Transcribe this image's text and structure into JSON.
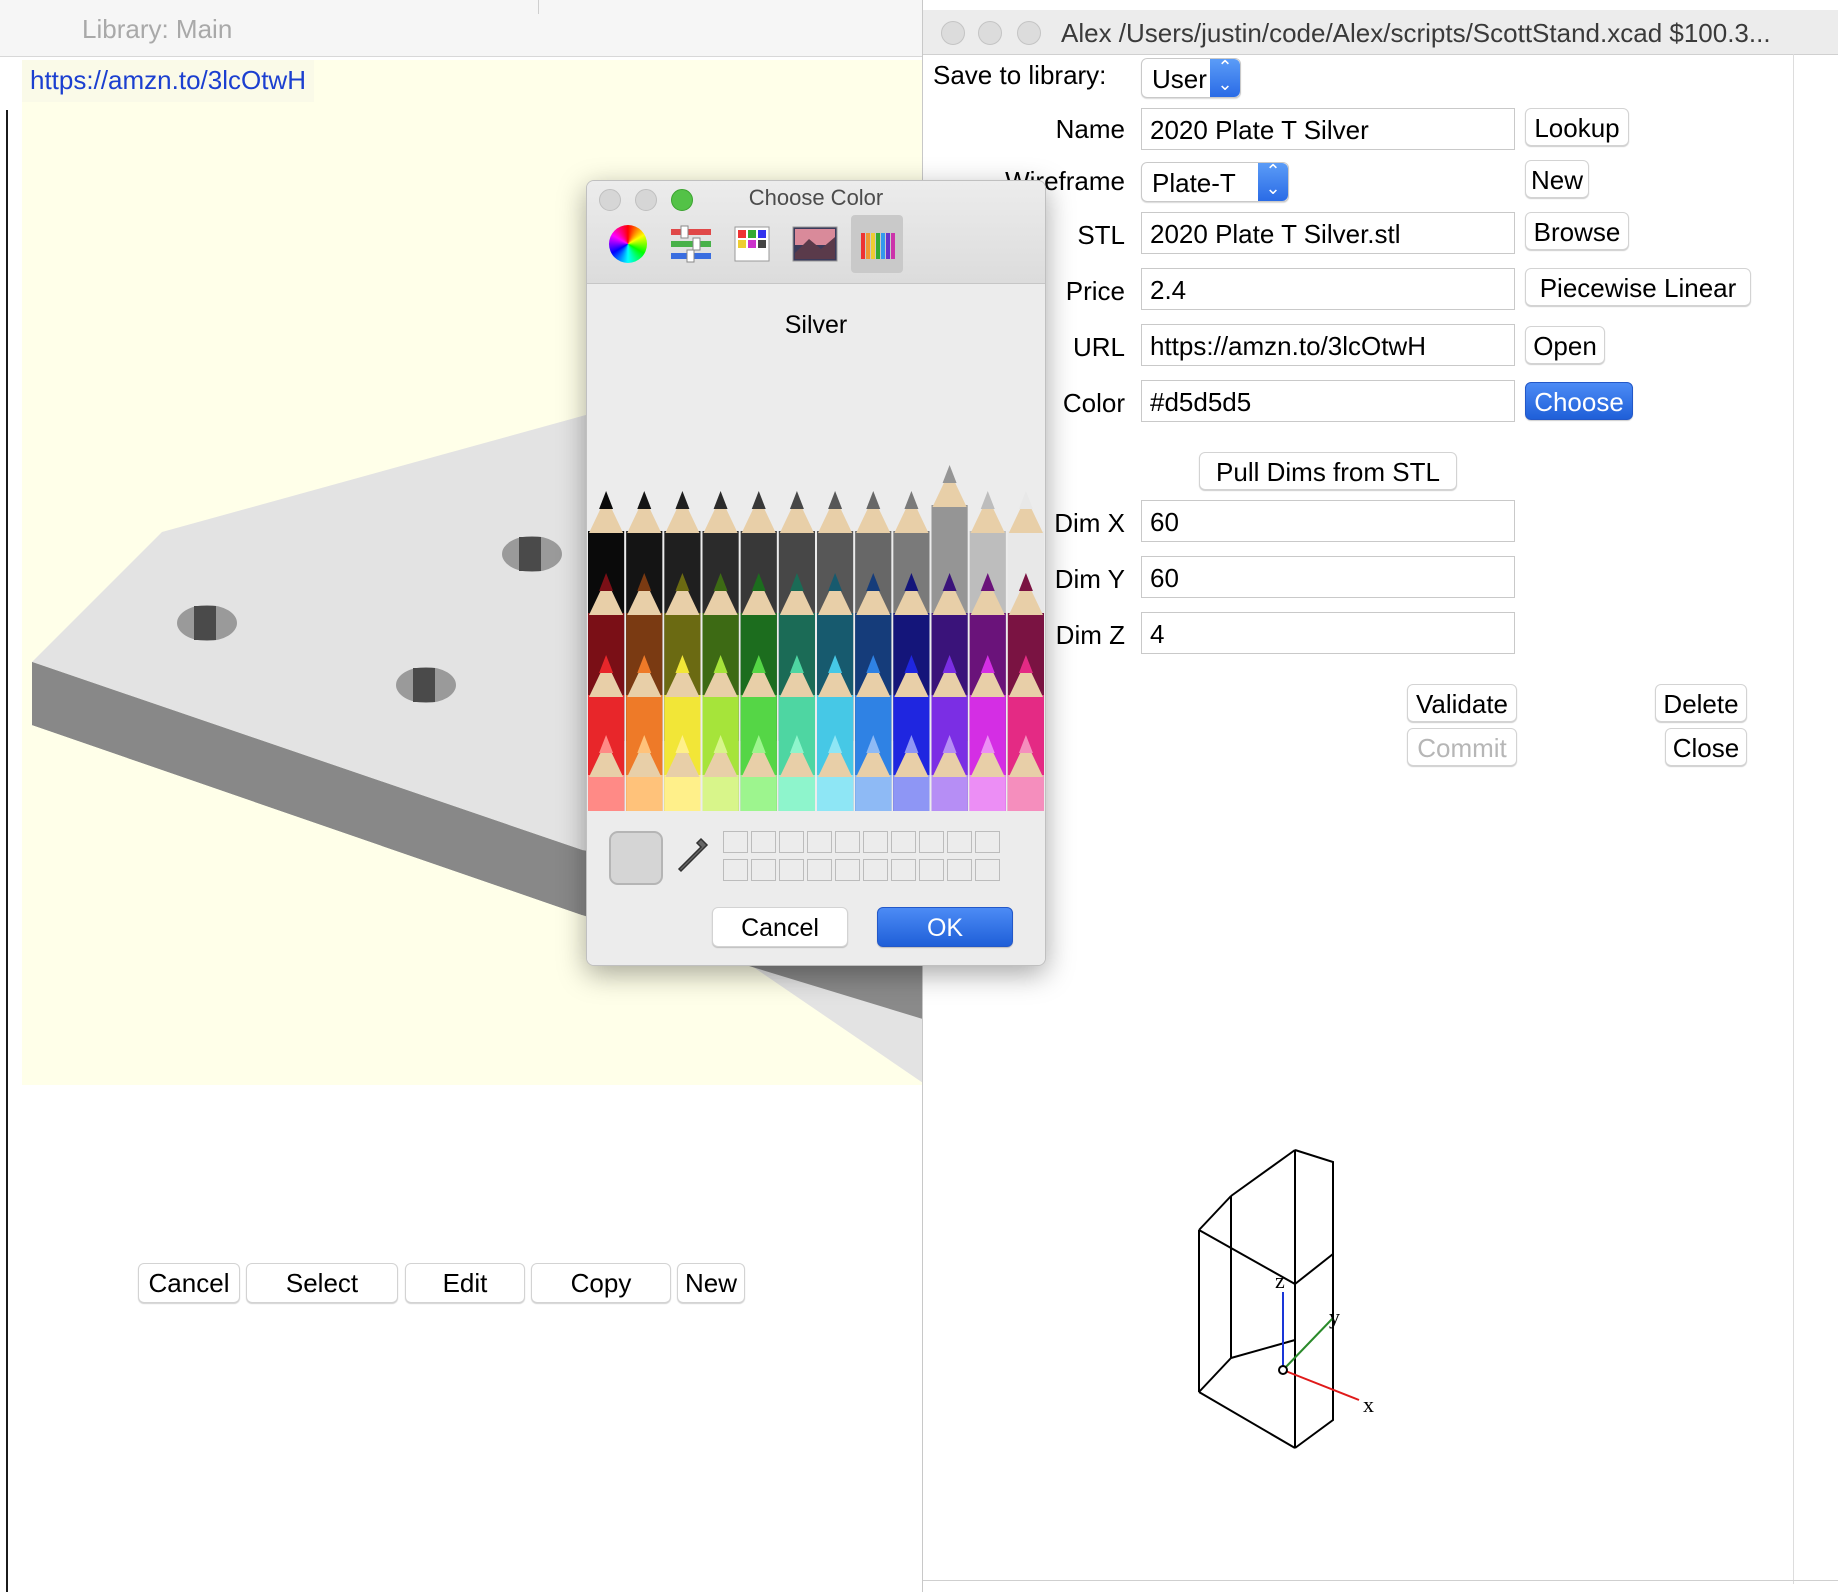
{
  "library_window": {
    "title": "Library: Main",
    "url_link": "https://amzn.to/3lcOtwH",
    "buttons": [
      "Cancel",
      "Select",
      "Edit",
      "Copy",
      "New"
    ]
  },
  "detail_window": {
    "title": "Alex /Users/justin/code/Alex/scripts/ScottStand.xcad $100.3...",
    "save_to_library_label": "Save to library:",
    "save_to_library_value": "User",
    "fields": {
      "name": {
        "label": "Name",
        "value": "2020 Plate T Silver",
        "button": "Lookup"
      },
      "wireframe": {
        "label": "Wireframe",
        "value": "Plate-T",
        "button": "New"
      },
      "stl": {
        "label": "STL",
        "value": "2020 Plate T Silver.stl",
        "button": "Browse"
      },
      "price": {
        "label": "Price",
        "value": "2.4",
        "button": "Piecewise Linear"
      },
      "url": {
        "label": "URL",
        "value": "https://amzn.to/3lcOtwH",
        "button": "Open"
      },
      "color": {
        "label": "Color",
        "value": "#d5d5d5",
        "button": "Choose"
      }
    },
    "pull_dims_button": "Pull Dims from STL",
    "dims": {
      "x": {
        "label": "Dim X",
        "value": "60"
      },
      "y": {
        "label": "Dim Y",
        "value": "60"
      },
      "z": {
        "label": "Dim Z",
        "value": "4"
      }
    },
    "actions": {
      "validate": "Validate",
      "delete": "Delete",
      "commit": "Commit",
      "close": "Close"
    },
    "axes": {
      "x": "x",
      "y": "y",
      "z": "z"
    }
  },
  "color_picker": {
    "title": "Choose Color",
    "selected_name": "Silver",
    "tabs": [
      "color-wheel",
      "color-sliders",
      "color-palettes",
      "image-palettes",
      "pencils"
    ],
    "active_tab": "pencils",
    "cancel": "Cancel",
    "ok": "OK",
    "current_color": "#d5d5d5"
  },
  "colors": {
    "accent": "#2f6ff0",
    "link": "#1b3fd0",
    "viewport_bg": "#ffffe9"
  }
}
